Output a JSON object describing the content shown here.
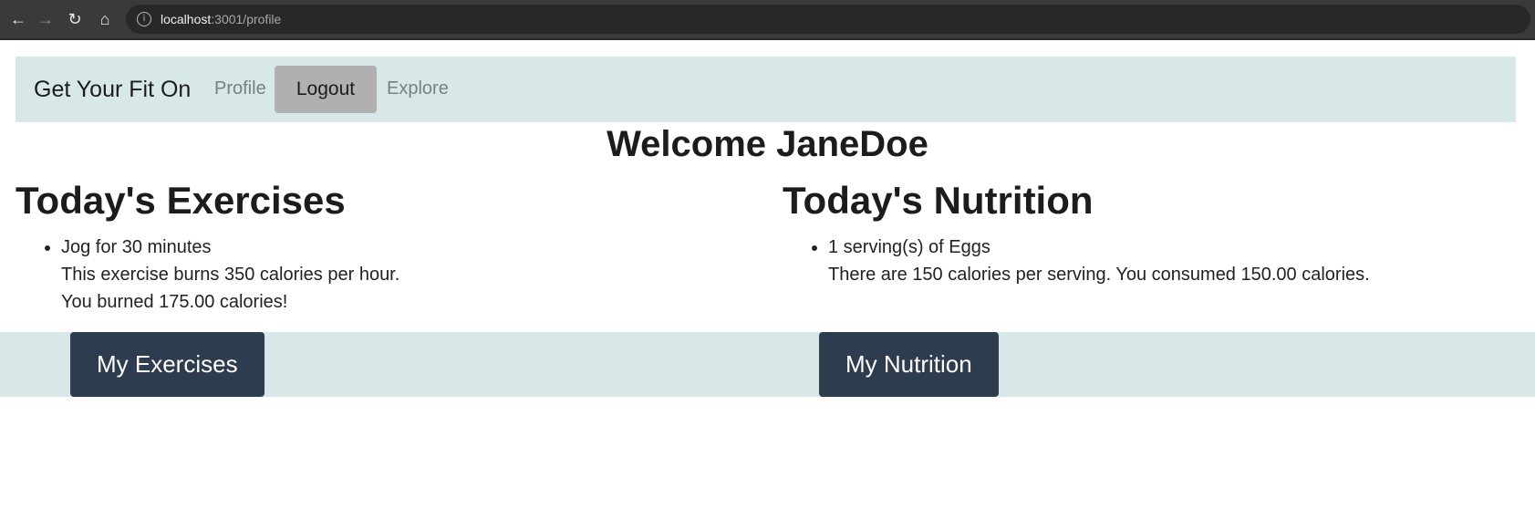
{
  "browser": {
    "url_host": "localhost",
    "url_path": ":3001/profile"
  },
  "navbar": {
    "brand": "Get Your Fit On",
    "links": [
      "Profile",
      "Logout",
      "Explore"
    ]
  },
  "page": {
    "welcome": "Welcome JaneDoe"
  },
  "exercises": {
    "title": "Today's Exercises",
    "items": [
      {
        "name": "Jog for 30 minutes",
        "detail": "This exercise burns 350 calories per hour.",
        "result": "You burned 175.00 calories!"
      }
    ],
    "button": "My Exercises"
  },
  "nutrition": {
    "title": "Today's Nutrition",
    "items": [
      {
        "name": "1 serving(s) of Eggs",
        "detail": "There are 150 calories per serving. You consumed 150.00 calories."
      }
    ],
    "button": "My Nutrition"
  },
  "colors": {
    "nav_bg": "#d8e8e8",
    "button_bg": "#2d3c4e",
    "logout_bg": "#b0b0b0"
  },
  "icons": [
    "back-arrow-icon",
    "forward-arrow-icon",
    "reload-icon",
    "home-icon",
    "info-icon"
  ]
}
